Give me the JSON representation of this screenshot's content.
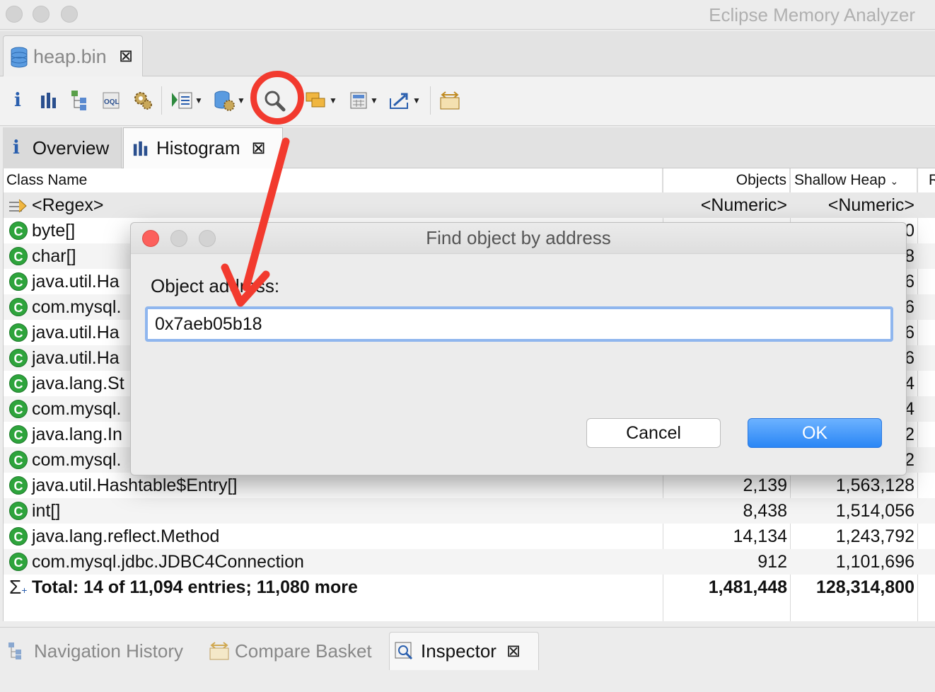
{
  "window": {
    "title": "Eclipse Memory Analyzer"
  },
  "editor_tab": {
    "label": "heap.bin"
  },
  "toolbar": {
    "icons": [
      "info-icon",
      "histogram-icon",
      "dominator-tree-icon",
      "oql-icon",
      "gear-icon",
      "query-browser-icon",
      "heap-dump-overview-icon",
      "find-object-icon",
      "group-icon",
      "calculator-icon",
      "export-icon",
      "compare-icon"
    ]
  },
  "inner_tabs": [
    {
      "label": "Overview"
    },
    {
      "label": "Histogram"
    }
  ],
  "table": {
    "headers": {
      "class_name": "Class Name",
      "objects": "Objects",
      "shallow_heap": "Shallow Heap",
      "retained": "R"
    },
    "filter": {
      "name": "<Regex>",
      "objects": "<Numeric>",
      "shallow": "<Numeric>"
    },
    "rows": [
      {
        "name": "byte[]",
        "objects": "",
        "shallow": "0"
      },
      {
        "name": "char[]",
        "objects": "",
        "shallow": "8"
      },
      {
        "name": "java.util.Ha",
        "objects": "",
        "shallow": "6"
      },
      {
        "name": "com.mysql.",
        "objects": "",
        "shallow": "6"
      },
      {
        "name": "java.util.Ha",
        "objects": "",
        "shallow": "6"
      },
      {
        "name": "java.util.Ha",
        "objects": "",
        "shallow": "6"
      },
      {
        "name": "java.lang.St",
        "objects": "",
        "shallow": "4"
      },
      {
        "name": "com.mysql.",
        "objects": "",
        "shallow": "4"
      },
      {
        "name": "java.lang.In",
        "objects": "",
        "shallow": "2"
      },
      {
        "name": "com.mysql.",
        "objects": "",
        "shallow": "2"
      },
      {
        "name": "java.util.Hashtable$Entry[]",
        "objects": "2,139",
        "shallow": "1,563,128"
      },
      {
        "name": "int[]",
        "objects": "8,438",
        "shallow": "1,514,056"
      },
      {
        "name": "java.lang.reflect.Method",
        "objects": "14,134",
        "shallow": "1,243,792"
      },
      {
        "name": "com.mysql.jdbc.JDBC4Connection",
        "objects": "912",
        "shallow": "1,101,696"
      }
    ],
    "total": {
      "name": "Total: 14 of 11,094 entries; 11,080 more",
      "objects": "1,481,448",
      "shallow": "128,314,800"
    }
  },
  "bottom_tabs": [
    {
      "label": "Navigation History"
    },
    {
      "label": "Compare Basket"
    },
    {
      "label": "Inspector"
    }
  ],
  "dialog": {
    "title": "Find object by address",
    "label": "Object address:",
    "input_value": "0x7aeb05b18",
    "cancel_label": "Cancel",
    "ok_label": "OK"
  },
  "colors": {
    "annotation_red": "#f23a2e",
    "ok_blue": "#2a86f5",
    "class_icon_green": "#2ea43c",
    "focus_ring": "#8fb6ee"
  }
}
